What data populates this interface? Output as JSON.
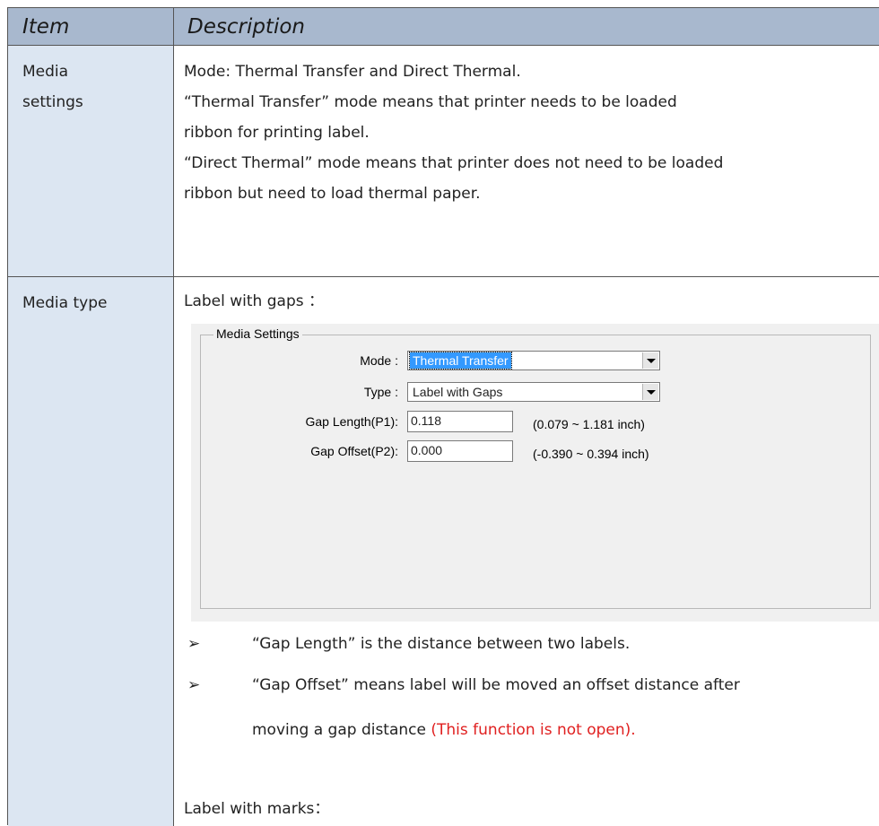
{
  "header": {
    "item": "Item",
    "description": "Description"
  },
  "rows": [
    {
      "item_lines": [
        "Media",
        "settings"
      ],
      "desc_lines": [
        "Mode: Thermal Transfer and Direct Thermal.",
        "“Thermal Transfer” mode means that printer needs to be loaded",
        "ribbon for printing label.",
        "“Direct Thermal” mode means that printer does not need to be loaded",
        "ribbon but need to load thermal paper."
      ]
    },
    {
      "item": "Media type",
      "label_gaps": "Label with gaps ：",
      "dialog": {
        "group_title": "Media Settings",
        "mode_label": "Mode :",
        "mode_value": "Thermal Transfer",
        "type_label": "Type :",
        "type_value": "Label with Gaps",
        "gap_length_label": "Gap Length(P1):",
        "gap_length_value": "0.118",
        "gap_length_range": "(0.079 ~ 1.181 inch)",
        "gap_offset_label": "Gap Offset(P2):",
        "gap_offset_value": "0.000",
        "gap_offset_range": "(-0.390 ~ 0.394 inch)"
      },
      "bullets": [
        {
          "mark": "➢",
          "text": "“Gap Length” is the distance between two labels."
        },
        {
          "mark": "➢",
          "text": "“Gap Offset” means label will be moved an offset distance after",
          "cont": "moving a gap distance ",
          "note": "(This function is not open)."
        }
      ],
      "label_marks": "Label with marks："
    }
  ],
  "colors": {
    "header_bg": "#a8b8ce",
    "item_bg": "#dce6f2",
    "note": "#e02020",
    "selection": "#3399ff"
  }
}
